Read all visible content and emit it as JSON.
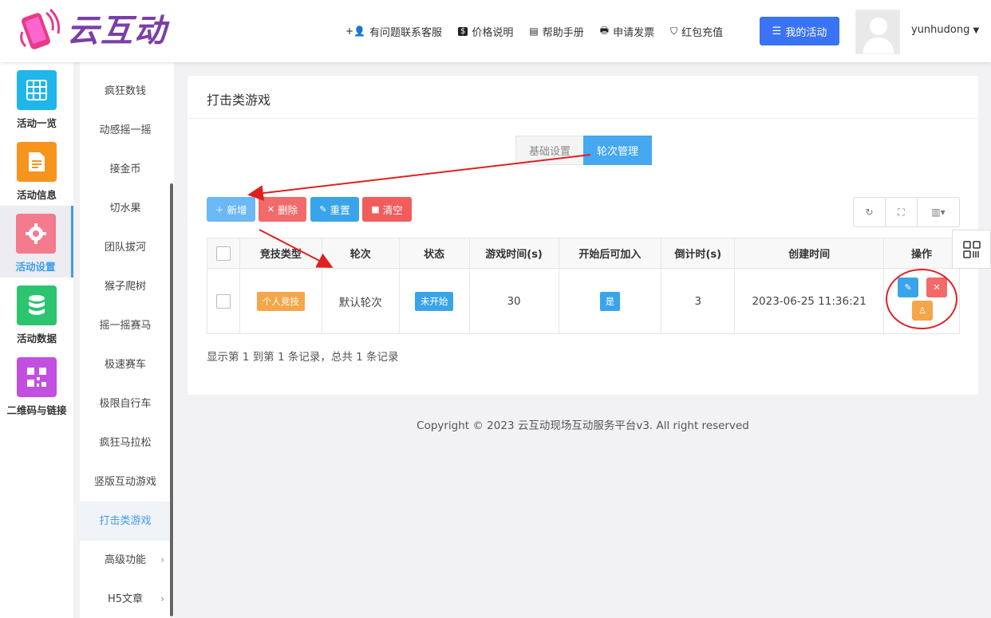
{
  "brand": {
    "name": "云互动"
  },
  "topnav": {
    "items": [
      {
        "label": "有问题联系客服",
        "icon": "add-user-icon"
      },
      {
        "label": "价格说明",
        "icon": "dollar-icon"
      },
      {
        "label": "帮助手册",
        "icon": "book-icon"
      },
      {
        "label": "申请发票",
        "icon": "print-icon"
      },
      {
        "label": "红包充值",
        "icon": "shield-check-icon"
      }
    ],
    "my_activity": "我的活动",
    "username": "yunhudong"
  },
  "sidebar": {
    "items": [
      {
        "label": "活动一览",
        "color": "#1fb6ea",
        "icon": "grid-icon"
      },
      {
        "label": "活动信息",
        "color": "#f7941d",
        "icon": "document-icon"
      },
      {
        "label": "活动设置",
        "color": "#f47a8e",
        "icon": "gear-icon",
        "active": true
      },
      {
        "label": "活动数据",
        "color": "#2cc46f",
        "icon": "database-icon"
      },
      {
        "label": "二维码与链接",
        "color": "#c24fe0",
        "icon": "qrcode-icon"
      }
    ]
  },
  "submenu": {
    "items": [
      "疯狂数钱",
      "动感摇一摇",
      "接金币",
      "切水果",
      "团队拔河",
      "猴子爬树",
      "摇一摇赛马",
      "极速赛车",
      "极限自行车",
      "疯狂马拉松",
      "竖版互动游戏",
      "打击类游戏",
      "高级功能",
      "H5文章"
    ],
    "active": "打击类游戏"
  },
  "page": {
    "title": "打击类游戏",
    "tabs": {
      "basic": "基础设置",
      "rounds": "轮次管理"
    },
    "toolbar": {
      "add": "新增",
      "delete": "删除",
      "reset": "重置",
      "clear": "清空"
    },
    "table": {
      "headers": [
        "竞技类型",
        "轮次",
        "状态",
        "游戏时间(s)",
        "开始后可加入",
        "倒计时(s)",
        "创建时间",
        "操作"
      ],
      "rows": [
        {
          "type": "个人竞技",
          "round": "默认轮次",
          "status": "未开始",
          "game_time": "30",
          "join_after": "是",
          "countdown": "3",
          "created": "2023-06-25 11:36:21"
        }
      ]
    },
    "pager": "显示第 1 到第 1 条记录，总共 1 条记录"
  },
  "footer": "Copyright © 2023 云互动现场互动服务平台v3. All right reserved",
  "colors": {
    "accent": "#3b73f5",
    "active_blue": "#3c9cf0",
    "annotation_red": "#e02020"
  }
}
